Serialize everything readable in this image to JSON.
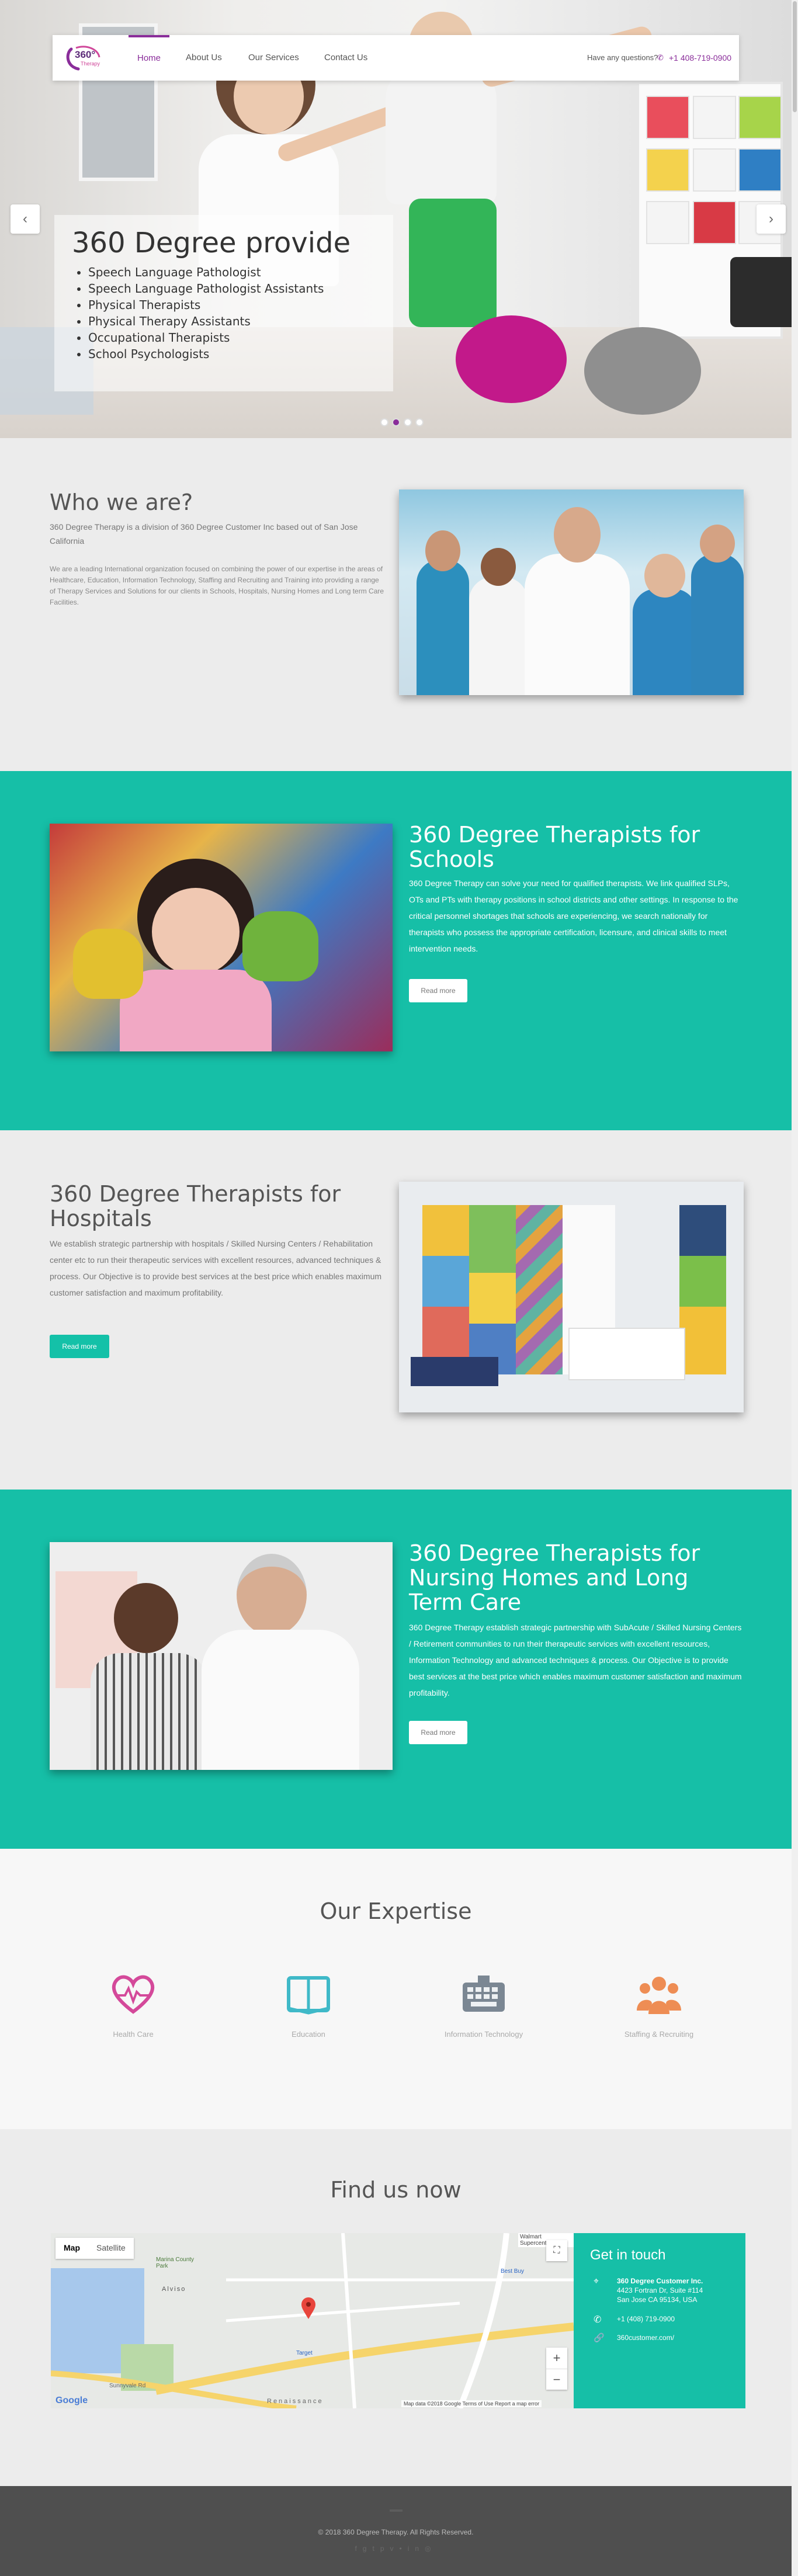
{
  "nav": {
    "items": [
      {
        "label": "Home"
      },
      {
        "label": "About Us"
      },
      {
        "label": "Our Services"
      },
      {
        "label": "Contact Us"
      }
    ],
    "question": "Have any questions?",
    "phone": "+1 408-719-0900",
    "logo_text": "360°",
    "logo_sub": "Therapy"
  },
  "hero": {
    "title": "360 Degree provide",
    "list": [
      "Speech Language Pathologist",
      "Speech Language Pathologist Assistants",
      "Physical Therapists",
      "Physical Therapy Assistants",
      "Occupational Therapists",
      "School Psychologists"
    ],
    "prev": "‹",
    "next": "›"
  },
  "who": {
    "title": "Who we are?",
    "lead": "360 Degree Therapy is a division of 360 Degree Customer Inc based out of San Jose California",
    "body": "We are a leading International organization focused on combining the power of our expertise in the areas of Healthcare, Education, Information Technology, Staffing and Recruiting and Training into providing a range of Therapy Services and Solutions for our clients in Schools, Hospitals, Nursing Homes and Long term Care Facilities."
  },
  "schools": {
    "title": "360 Degree Therapists for Schools",
    "body": "360 Degree Therapy can solve your need for qualified therapists. We link qualified SLPs, OTs and PTs with therapy positions in school districts and other settings. In response to the critical personnel shortages that schools are experiencing, we search nationally for therapists who possess the appropriate certification, licensure, and clinical skills to meet intervention needs.",
    "button": "Read more"
  },
  "hospitals": {
    "title": "360 Degree Therapists for Hospitals",
    "body": "We establish strategic partnership with hospitals / Skilled Nursing Centers / Rehabilitation center etc to run their therapeutic services with excellent resources, advanced techniques & process. Our Objective is to provide best services at the best price which enables maximum customer satisfaction and maximum profitability.",
    "button": "Read more"
  },
  "nursing": {
    "title": "360 Degree Therapists for Nursing Homes and Long Term Care",
    "body": "360 Degree Therapy establish strategic partnership with SubAcute / Skilled Nursing Centers / Retirement communities to run their therapeutic services with excellent resources, Information Technology and advanced techniques & process. Our Objective is to provide best services at the best price which enables maximum customer satisfaction and maximum profitability.",
    "button": "Read more"
  },
  "expertise": {
    "title": "Our Expertise",
    "items": [
      {
        "label": "Health Care",
        "icon": "heart-pulse-icon",
        "color": "#d4499a"
      },
      {
        "label": "Education",
        "icon": "book-icon",
        "color": "#3fb9c8"
      },
      {
        "label": "Information Technology",
        "icon": "keyboard-icon",
        "color": "#7b8793"
      },
      {
        "label": "Staffing & Recruiting",
        "icon": "people-icon",
        "color": "#ee8d54"
      }
    ]
  },
  "find": {
    "title": "Find us now",
    "map_tab_map": "Map",
    "map_tab_sat": "Satellite",
    "map_footer": "Map data ©2018 Google   Terms of Use   Report a map error",
    "map_labels": [
      "Alviso",
      "Marina County Park",
      "Walmart Supercenter",
      "Best Buy",
      "Target",
      "Renaissance",
      "Sunnyvale Rd"
    ],
    "google": "Google",
    "contact_title": "Get in touch",
    "company": "360 Degree Customer Inc.",
    "address1": "4423 Fortran Dr, Suite #114",
    "address2": "San Jose CA 95134, USA",
    "phone": "+1 (408) 719-0900",
    "web": "360customer.com/"
  },
  "footer": {
    "copyright": "© 2018 360 Degree Therapy. All Rights Reserved."
  },
  "colors": {
    "brand": "#8a2d9a",
    "teal": "#16bfa7"
  }
}
